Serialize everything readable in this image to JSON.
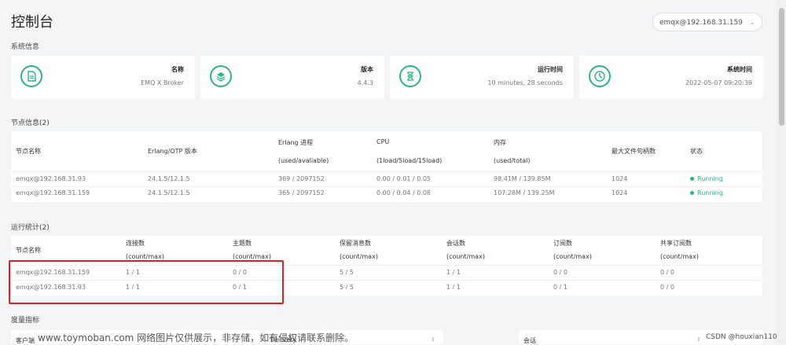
{
  "page": {
    "title": "控制台"
  },
  "node_selector": {
    "value": "emqx@192.168.31.159",
    "chevron": "chevron-down-icon"
  },
  "system_info": {
    "section_title": "系统信息",
    "cards": [
      {
        "label": "名称",
        "value": "EMQ X Broker",
        "icon": "document-icon"
      },
      {
        "label": "版本",
        "value": "4.4.3",
        "icon": "layers-icon"
      },
      {
        "label": "运行时间",
        "value": "10 minutes, 28 seconds",
        "icon": "hourglass-icon"
      },
      {
        "label": "系统时间",
        "value": "2022-05-07 09:20:39",
        "icon": "clock-icon"
      }
    ]
  },
  "nodes": {
    "section_title": "节点信息(2)",
    "headers": {
      "name": "节点名称",
      "otp": "Erlang/OTP 版本",
      "erlang": "Erlang 进程",
      "erlang_sub": "(used/avaliable)",
      "cpu": "CPU",
      "cpu_sub": "(1load/5load/15load)",
      "memory": "内存",
      "memory_sub": "(used/total)",
      "max_fds": "最大文件句柄数",
      "status": "状态"
    },
    "rows": [
      {
        "name": "emqx@192.168.31.93",
        "otp": "24.1.5/12.1.5",
        "erlang": "369 / 2097152",
        "cpu": "0.00 / 0.01 / 0.05",
        "memory": "98.41M / 139.85M",
        "max_fds": "1024",
        "status": "Running"
      },
      {
        "name": "emqx@192.168.31.159",
        "otp": "24.1.5/12.1.5",
        "erlang": "365 / 2097152",
        "cpu": "0.00 / 0.04 / 0.08",
        "memory": "107.28M / 139.25M",
        "max_fds": "1024",
        "status": "Running"
      }
    ]
  },
  "stats": {
    "section_title": "运行统计(2)",
    "headers": {
      "name": "节点名称",
      "connections": "连接数",
      "topics": "主题数",
      "retained": "保留消息数",
      "sessions": "会话数",
      "subscriptions": "订阅数",
      "shared": "共享订阅数",
      "sub": "(count/max)"
    },
    "rows": [
      {
        "name": "emqx@192.168.31.159",
        "connections": "1 / 1",
        "topics": "0 / 0",
        "retained": "5 / 5",
        "sessions": "1 / 1",
        "subscriptions": "0 / 0",
        "shared": "0 / 0"
      },
      {
        "name": "emqx@192.168.31.93",
        "connections": "1 / 1",
        "topics": "0 / 1",
        "retained": "5 / 5",
        "sessions": "1 / 1",
        "subscriptions": "0 / 1",
        "shared": "0 / 0"
      }
    ]
  },
  "metrics": {
    "section_title": "度量指标",
    "col1": "客户端",
    "col2": "Delivery",
    "col3": "会话"
  },
  "watermark": {
    "text": "www.toymoban.com 网络图片仅供展示，非存储，如有侵权请联系删除。",
    "credit": "CSDN @houxian1103"
  },
  "colors": {
    "accent": "#2bb585",
    "highlight_box": "#e02020",
    "background": "#f3f5f7"
  }
}
